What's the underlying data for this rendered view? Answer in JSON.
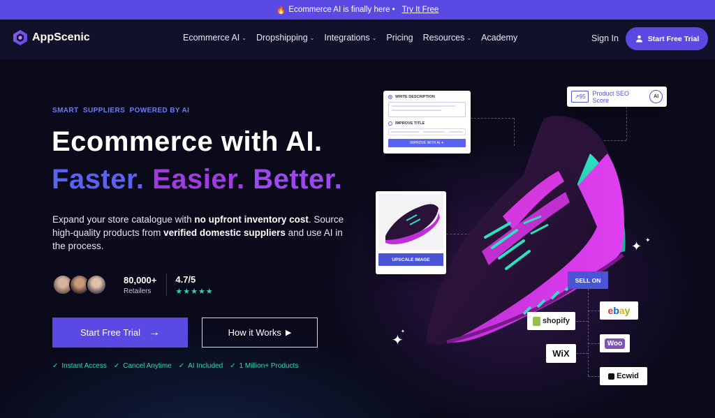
{
  "announcement": {
    "icon": "flame-icon",
    "text": "Ecommerce AI is finally here •",
    "link": "Try It Free"
  },
  "nav": {
    "brand": "AppScenic",
    "items": [
      {
        "label": "Ecommerce AI",
        "dropdown": true
      },
      {
        "label": "Dropshipping",
        "dropdown": true
      },
      {
        "label": "Integrations",
        "dropdown": true
      },
      {
        "label": "Pricing",
        "dropdown": false
      },
      {
        "label": "Resources",
        "dropdown": true
      },
      {
        "label": "Academy",
        "dropdown": false
      }
    ],
    "sign_in": "Sign In",
    "cta": "Start Free Trial"
  },
  "hero": {
    "eyebrow": "SMART  SUPPLIERS  POWERED BY AI",
    "title": "Ecommerce with AI.",
    "subtitle_words": [
      "Faster.",
      "Easier.",
      "Better."
    ],
    "description_parts": [
      "Expand your store catalogue with ",
      "no upfront inventory cost",
      ". Source high-quality products from ",
      "verified domestic suppliers",
      " and use AI in the process."
    ],
    "retailers_count": "80,000+",
    "retailers_label": "Retailers",
    "rating": "4.7/5",
    "stars": 5,
    "primary_button": "Start Free Trial",
    "secondary_button": "How it Works",
    "features": [
      "Instant Access",
      "Cancel Anytime",
      "AI Included",
      "1 Million+ Products"
    ]
  },
  "visual": {
    "write_description": "WRITE DESCRIPTION",
    "improve_title": "IMPROVE TITLE",
    "improve_with_ai": "IMPROVE WITH AI",
    "seo_score": "95",
    "seo_label": "Product SEO Score",
    "seo_badge": "AI",
    "upscale_button": "UPSCALE IMAGE",
    "sell_on": "SELL ON",
    "platforms": {
      "shopify": "shopify",
      "ebay": [
        "e",
        "b",
        "a",
        "y"
      ],
      "wix": "WiX",
      "woo": "Woo",
      "ecwid": "Ecwid"
    }
  },
  "colors": {
    "accent": "#5b49e3",
    "teal": "#2ed3b7",
    "shoe_purple": "#c02ed8",
    "shoe_teal": "#2ee0c0"
  }
}
